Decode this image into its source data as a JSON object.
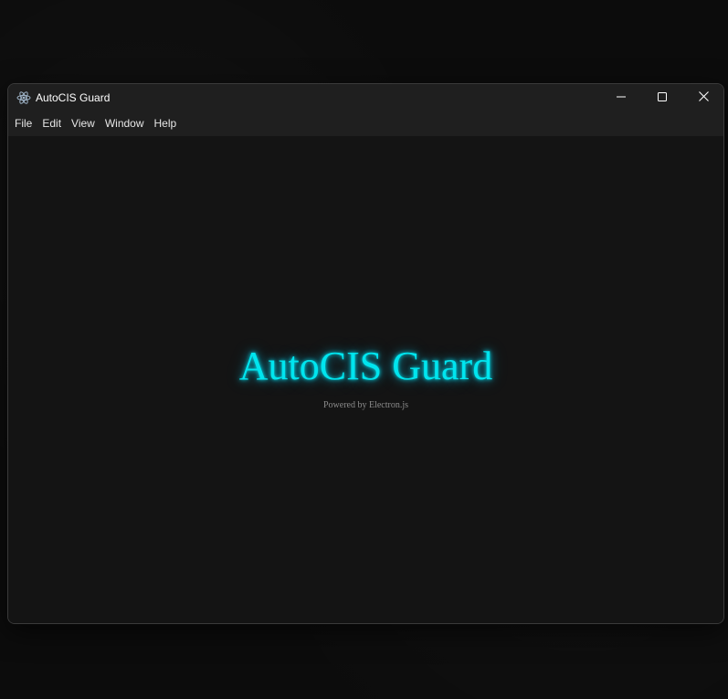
{
  "window": {
    "title": "AutoCIS Guard",
    "icon": "electron-atom-icon",
    "controls": {
      "minimize": "minimize-icon",
      "maximize": "maximize-icon",
      "close": "close-icon"
    }
  },
  "menubar": {
    "items": [
      {
        "label": "File"
      },
      {
        "label": "Edit"
      },
      {
        "label": "View"
      },
      {
        "label": "Window"
      },
      {
        "label": "Help"
      }
    ]
  },
  "main": {
    "heading": "AutoCIS Guard",
    "subheading": "Powered by Electron.js"
  },
  "colors": {
    "accent": "#00e5ef",
    "background": "#141414",
    "titlebar": "#1f1f1f"
  }
}
